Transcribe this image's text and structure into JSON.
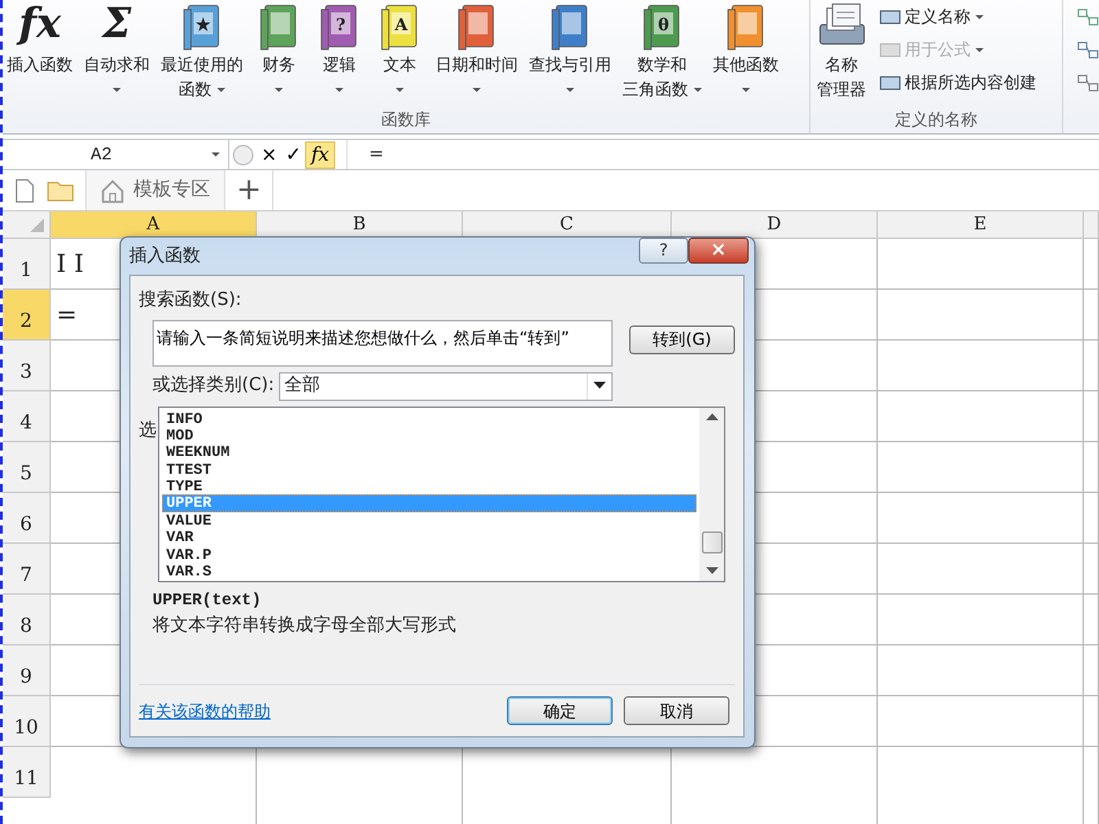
{
  "ribbon": {
    "groups": [
      {
        "label": "函数库",
        "buttons": [
          {
            "kind": "glyph",
            "glyph": "fx",
            "lines": [
              "插入函数"
            ],
            "dropdown": false
          },
          {
            "kind": "glyph",
            "glyph": "Σ",
            "lines": [
              "自动求和"
            ],
            "dropdown": true
          },
          {
            "kind": "book",
            "color": "#5aa0d8",
            "glyph": "★",
            "lines": [
              "最近使用的",
              "函数"
            ],
            "dropdown": true
          },
          {
            "kind": "book",
            "color": "#5ea35a",
            "lines": [
              "财务"
            ],
            "dropdown": true
          },
          {
            "kind": "book",
            "color": "#a05cb0",
            "glyph": "?",
            "lines": [
              "逻辑"
            ],
            "dropdown": true
          },
          {
            "kind": "book",
            "color": "#ece040",
            "glyph": "A",
            "lines": [
              "文本"
            ],
            "dropdown": true
          },
          {
            "kind": "book",
            "color": "#e0603c",
            "lines": [
              "日期和时间"
            ],
            "dropdown": true
          },
          {
            "kind": "book",
            "color": "#3f7fc8",
            "lines": [
              "查找与引用"
            ],
            "dropdown": true
          },
          {
            "kind": "book",
            "color": "#4e9a50",
            "glyph": "θ",
            "lines": [
              "数学和",
              "三角函数"
            ],
            "dropdown": true
          },
          {
            "kind": "book",
            "color": "#f09030",
            "lines": [
              "其他函数"
            ],
            "dropdown": true
          }
        ]
      },
      {
        "label": "定义的名称",
        "buttons": [
          {
            "kind": "manager",
            "lines": [
              "名称",
              "管理器"
            ],
            "dropdown": false
          }
        ],
        "small_buttons": [
          {
            "label": "定义名称",
            "dropdown": true,
            "disabled": false
          },
          {
            "label": "用于公式",
            "dropdown": true,
            "disabled": true
          },
          {
            "label": "根据所选内容创建",
            "dropdown": false,
            "disabled": false
          }
        ]
      }
    ]
  },
  "formula_bar": {
    "name_box": "A2",
    "buttons": [
      {
        "label": "×",
        "highlighted": false
      },
      {
        "label": "✓",
        "highlighted": false
      },
      {
        "label": "fx",
        "highlighted": true
      }
    ],
    "formula": "="
  },
  "tab_bar": {
    "tabs": [
      {
        "label": "模板专区"
      }
    ],
    "add": "+"
  },
  "sheet": {
    "columns": [
      {
        "label": "A",
        "selected": true
      },
      {
        "label": "B",
        "selected": false
      },
      {
        "label": "C",
        "selected": false
      },
      {
        "label": "D",
        "selected": false
      },
      {
        "label": "E",
        "selected": false
      }
    ],
    "rows": [
      {
        "label": "1",
        "selected": false,
        "cells": [
          "I I"
        ]
      },
      {
        "label": "2",
        "selected": true,
        "cells": [
          "="
        ]
      },
      {
        "label": "3",
        "selected": false
      },
      {
        "label": "4",
        "selected": false
      },
      {
        "label": "5",
        "selected": false
      },
      {
        "label": "6",
        "selected": false
      },
      {
        "label": "7",
        "selected": false
      },
      {
        "label": "8",
        "selected": false
      },
      {
        "label": "9",
        "selected": false
      },
      {
        "label": "10",
        "selected": false
      },
      {
        "label": "11",
        "selected": false
      }
    ]
  },
  "dialog": {
    "title": "插入函数",
    "help": "?",
    "close": "×",
    "search_label": "搜索函数(S):",
    "search_value": "请输入一条简短说明来描述您想做什么，然后单击“转到”",
    "go_button": "转到(G)",
    "category_label": "或选择类别(C):",
    "category_value": "全部",
    "select_label": "选",
    "functions": [
      {
        "name": "INFO",
        "selected": false
      },
      {
        "name": "MOD",
        "selected": false
      },
      {
        "name": "WEEKNUM",
        "selected": false
      },
      {
        "name": "TTEST",
        "selected": false
      },
      {
        "name": "TYPE",
        "selected": false
      },
      {
        "name": "UPPER",
        "selected": true
      },
      {
        "name": "VALUE",
        "selected": false
      },
      {
        "name": "VAR",
        "selected": false
      },
      {
        "name": "VAR.P",
        "selected": false
      },
      {
        "name": "VAR.S",
        "selected": false
      }
    ],
    "signature": "UPPER(text)",
    "description": "将文本字符串转换成字母全部大写形式",
    "help_link": "有关该函数的帮助",
    "ok_button": "确定",
    "cancel_button": "取消"
  }
}
